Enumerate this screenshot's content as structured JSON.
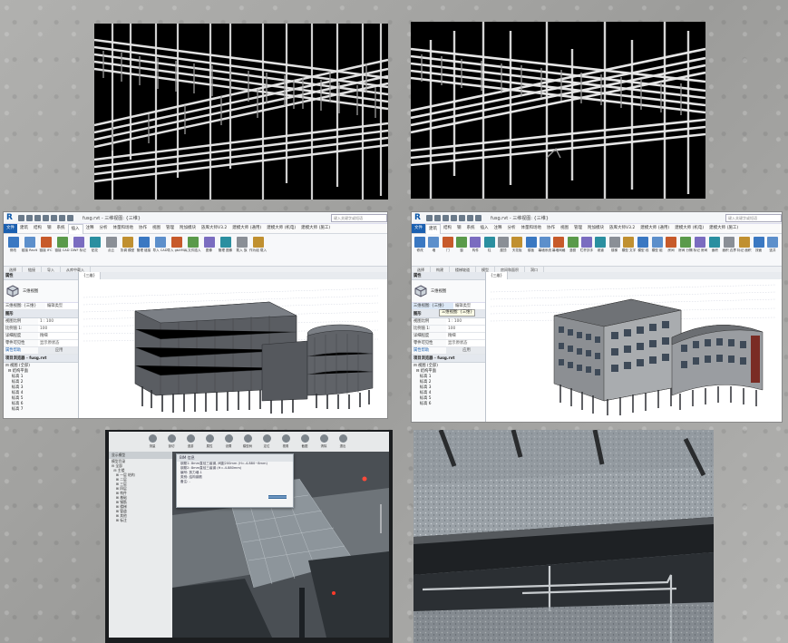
{
  "left_window": {
    "app_logo": "R",
    "title": "fusg.rvt - 三维视图: {三维}",
    "search_placeholder": "键入关键字或短语",
    "tabs": [
      "文件",
      "建筑",
      "结构",
      "钢",
      "系统",
      "插入",
      "注释",
      "分析",
      "体量和场地",
      "协作",
      "视图",
      "管理",
      "附加模块",
      "族库大师V3.2",
      "建模大师 (通用)",
      "建模大师 (机电)",
      "建模大师 (施工)"
    ],
    "active_tab": "插入",
    "ribbon": [
      "修改",
      "链接 Revit",
      "链接 IFC",
      "链接 CAD",
      "DWF 标记",
      "贴花",
      "点云",
      "协调 模型",
      "管理 链接",
      "导入 CAD",
      "导入 gbXML",
      "从文件插入",
      "图像",
      "管理 图像",
      "载入 族",
      "作为组 载入"
    ],
    "ribbon_panels": [
      "选择",
      "链接",
      "导入",
      "从库中载入"
    ],
    "properties_title": "属性",
    "type_name": "三维视图",
    "view_selector": "三维视图: {三维}",
    "edit_type": "编辑类型",
    "section_graphics": "图形",
    "props": [
      {
        "k": "视图比例",
        "v": "1 : 100"
      },
      {
        "k": "比例值 1:",
        "v": "100"
      },
      {
        "k": "详细程度",
        "v": "精细"
      },
      {
        "k": "零件可见性",
        "v": "显示原状态"
      }
    ],
    "help_link": "属性帮助",
    "apply": "应用",
    "browser_title": "项目浏览器 - fusg.rvt",
    "tree": [
      "⊟ 视图 (全部)",
      "  ⊟ 结构平面",
      "     标高 1",
      "     标高 2",
      "     标高 3",
      "     标高 4",
      "     标高 5",
      "     标高 6",
      "     标高 7"
    ],
    "view_tabs": [
      "{三维}"
    ]
  },
  "right_window": {
    "app_logo": "R",
    "title": "fusg.rvt - 三维视图: {三维}",
    "search_placeholder": "键入关键字或短语",
    "tabs": [
      "文件",
      "建筑",
      "结构",
      "钢",
      "系统",
      "插入",
      "注释",
      "分析",
      "体量和场地",
      "协作",
      "视图",
      "管理",
      "附加模块",
      "族库大师V3.2",
      "建模大师 (通用)",
      "建模大师 (机电)",
      "建模大师 (施工)"
    ],
    "active_tab": "建筑",
    "ribbon": [
      "修改",
      "墙",
      "门",
      "窗",
      "构件",
      "柱",
      "屋顶",
      "天花板",
      "楼板",
      "幕墙系统",
      "幕墙网格",
      "竖梃",
      "栏杆扶手",
      "坡道",
      "楼梯",
      "模型 文字",
      "模型 线",
      "模型 组",
      "房间",
      "房间 分隔",
      "标记 房间",
      "面积",
      "面积 边界",
      "标记 面积",
      "按面",
      "竖井"
    ],
    "ribbon_panels": [
      "选择",
      "构建",
      "楼梯坡道",
      "模型",
      "房间和面积",
      "洞口"
    ],
    "properties_title": "属性",
    "type_name": "三维视图",
    "view_selector": "三维视图: {三维}",
    "edit_type": "编辑类型",
    "tooltip": "三维视图: {三维}",
    "section_graphics": "图形",
    "props": [
      {
        "k": "视图比例",
        "v": "1 : 100"
      },
      {
        "k": "比例值 1:",
        "v": "100"
      },
      {
        "k": "详细程度",
        "v": "精细"
      },
      {
        "k": "零件可见性",
        "v": "显示原状态"
      }
    ],
    "help_link": "属性帮助",
    "apply": "应用",
    "browser_title": "项目浏览器 - fusg.rvt",
    "tree": [
      "⊟ 视图 (全部)",
      "  ⊟ 结构平面",
      "     标高 1",
      "     标高 2",
      "     标高 3",
      "     标高 4",
      "     标高 5",
      "     标高 6"
    ],
    "view_tabs": [
      "{三维}"
    ]
  },
  "bim_photo": {
    "toolbar": [
      "测量",
      "剖切",
      "漫游",
      "属性",
      "设置",
      "模型树",
      "定位",
      "视角",
      "截图",
      "清除",
      "退出"
    ],
    "side_title": "显示模型",
    "side_rows": [
      "模型目录",
      "⊟ 全部",
      "  ⊟ 主楼",
      "    ⊞ 一层 结构",
      "    ⊞ 二层",
      "    ⊞ 三层",
      "    ⊞ 四层",
      "    ⊞ 构件",
      "    ⊞ 基础",
      "    ⊞ 钢筋",
      "    ⊞ 楼梯",
      "    ⊞ 管道",
      "    ⊞ 其他",
      "    ⊞ 标注"
    ],
    "popup_title": "BIM 信息",
    "popup_lines": [
      "钢筋1: 8mm直径三级钢, 间距200mm (H=-4.880~8mm)",
      "钢筋2: 8mm直径三级钢 (H=-4.880mm)",
      "编号: 剪力墙-1",
      "类别: 结构钢筋",
      "备注: -"
    ]
  },
  "colors": {
    "revit_blue": "#1b60b0",
    "rebar_bg": "#000000",
    "wall_backdrop": "#a9a9a7"
  }
}
